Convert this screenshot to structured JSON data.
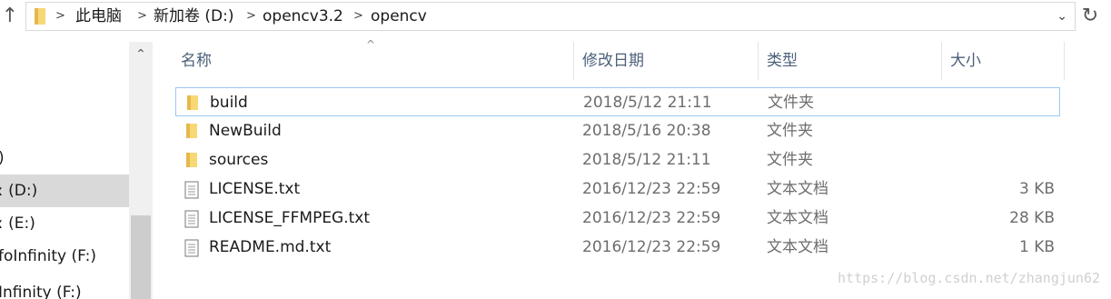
{
  "address_bar": {
    "crumbs": [
      "此电脑",
      "新加卷 (D:)",
      "opencv3.2",
      "opencv"
    ]
  },
  "nav": {
    "items": [
      ")",
      "ː (D:)",
      "ː (E:)",
      "foInfinity (F:)",
      "Infinity (F:)"
    ]
  },
  "list": {
    "columns": [
      "名称",
      "修改日期",
      "类型",
      "大小"
    ],
    "rows": [
      {
        "name": "build",
        "date": "2018/5/12 21:11",
        "type": "文件夹",
        "size": "",
        "icon": "folder-icon"
      },
      {
        "name": "NewBuild",
        "date": "2018/5/16 20:38",
        "type": "文件夹",
        "size": "",
        "icon": "folder-icon"
      },
      {
        "name": "sources",
        "date": "2018/5/12 21:11",
        "type": "文件夹",
        "size": "",
        "icon": "folder-icon"
      },
      {
        "name": "LICENSE.txt",
        "date": "2016/12/23 22:59",
        "type": "文本文档",
        "size": "3 KB",
        "icon": "text-file-icon"
      },
      {
        "name": "LICENSE_FFMPEG.txt",
        "date": "2016/12/23 22:59",
        "type": "文本文档",
        "size": "28 KB",
        "icon": "text-file-icon"
      },
      {
        "name": "README.md.txt",
        "date": "2016/12/23 22:59",
        "type": "文本文档",
        "size": "1 KB",
        "icon": "text-file-icon"
      }
    ]
  },
  "watermark": "https://blog.csdn.net/zhangjun62",
  "colors": {
    "selection": "#d9d9d9",
    "focus_border": "#99c9ef",
    "folder": "#f8d775",
    "header_text": "#4c607a"
  }
}
